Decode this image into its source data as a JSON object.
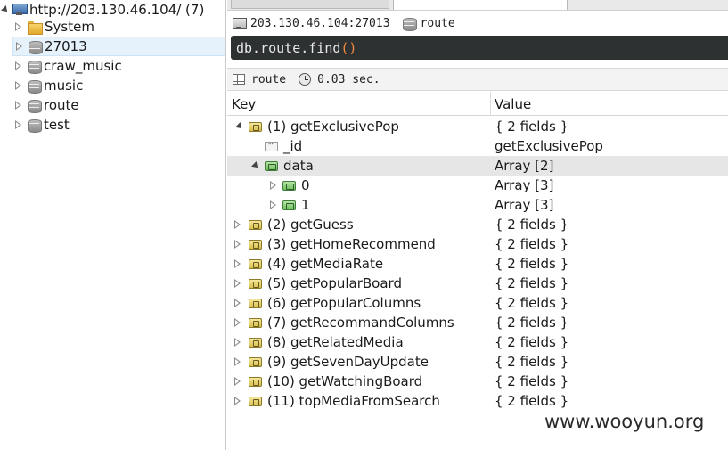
{
  "tree": {
    "server": {
      "label": "http://203.130.46.104/ (7)",
      "icon": "server-icon"
    },
    "items": [
      {
        "label": "System",
        "icon": "folder-icon"
      },
      {
        "label": "27013",
        "icon": "database-icon",
        "selected": true
      },
      {
        "label": "craw_music",
        "icon": "database-icon"
      },
      {
        "label": "music",
        "icon": "database-icon"
      },
      {
        "label": "route",
        "icon": "database-icon"
      },
      {
        "label": "test",
        "icon": "database-icon"
      }
    ]
  },
  "connection": {
    "host": "203.130.46.104:27013",
    "database": "route"
  },
  "query": {
    "text_main": "db.route.find",
    "text_parens": "()"
  },
  "result": {
    "collection": "route",
    "time": "0.03 sec."
  },
  "table": {
    "headers": {
      "key": "Key",
      "value": "Value"
    },
    "rows": [
      {
        "key": "(1) getExclusivePop",
        "value": "{ 2 fields }"
      },
      {
        "key": "_id",
        "value": "getExclusivePop"
      },
      {
        "key": "data",
        "value": "Array [2]"
      },
      {
        "key": "0",
        "value": "Array [3]"
      },
      {
        "key": "1",
        "value": "Array [3]"
      },
      {
        "key": "(2) getGuess",
        "value": "{ 2 fields }"
      },
      {
        "key": "(3) getHomeRecommend",
        "value": "{ 2 fields }"
      },
      {
        "key": "(4) getMediaRate",
        "value": "{ 2 fields }"
      },
      {
        "key": "(5) getPopularBoard",
        "value": "{ 2 fields }"
      },
      {
        "key": "(6) getPopularColumns",
        "value": "{ 2 fields }"
      },
      {
        "key": "(7) getRecommandColumns",
        "value": "{ 2 fields }"
      },
      {
        "key": "(8) getRelatedMedia",
        "value": "{ 2 fields }"
      },
      {
        "key": "(9) getSevenDayUpdate",
        "value": "{ 2 fields }"
      },
      {
        "key": "(10) getWatchingBoard",
        "value": "{ 2 fields }"
      },
      {
        "key": "(11) topMediaFromSearch",
        "value": "{ 2 fields }"
      }
    ]
  },
  "watermark": "www.wooyun.org"
}
